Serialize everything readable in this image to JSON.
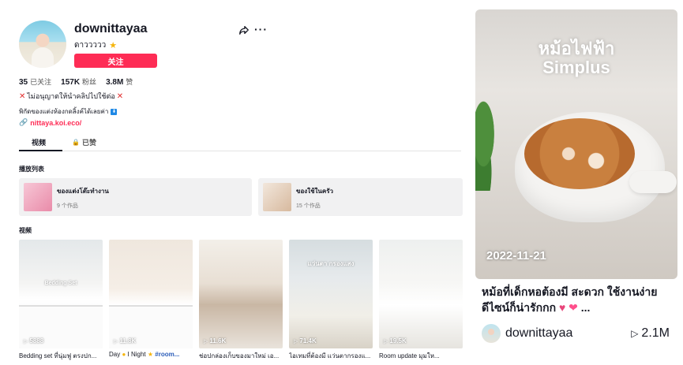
{
  "profile": {
    "username": "downittayaa",
    "nickname": "ดาววววว",
    "follow_label": "关注",
    "stats": [
      {
        "value": "35",
        "label": "已关注"
      },
      {
        "value": "157K",
        "label": "粉丝"
      },
      {
        "value": "3.8M",
        "label": "赞"
      }
    ],
    "bio_line1": "ไม่อนุญาตให้นำคลิปไปใช้ต่อ",
    "bio_line2": "พิกัดของแต่งห้องกดลิ้งค์ได้เลยค่า",
    "link": "nittaya.koi.eco/"
  },
  "tabs": {
    "videos": "视频",
    "liked": "已赞"
  },
  "playlists": {
    "title": "播放列表",
    "items": [
      {
        "name": "ของแต่งโต๊ะทำงาน",
        "count": "9 个作品"
      },
      {
        "name": "ของใช้ในครัว",
        "count": "15 个作品"
      }
    ]
  },
  "videos": {
    "title": "视频",
    "items": [
      {
        "views": "5888",
        "caption": "Bedding set ที่นุ่มฟู ตรงปก...",
        "overlay": "Bedding Set"
      },
      {
        "views": "11.8K",
        "caption_pre": "Day ",
        "caption_mid": " I Night ",
        "caption_tag": "#room...",
        "overlay": ""
      },
      {
        "views": "11.6K",
        "caption": "ช่อปกล่องเก็บของมาใหม่ เอ...",
        "overlay": ""
      },
      {
        "views": "71.4K",
        "caption": "ไอเทมที่ต้องมี แว่นตากรองแ...",
        "overlay": "แว่นตา กรองแสง"
      },
      {
        "views": "19.5K",
        "caption": "Room update  มุมให...",
        "overlay": ""
      }
    ]
  },
  "featured": {
    "title_line1": "หม้อไฟฟ้า",
    "title_line2": "Simplus",
    "date": "2022-11-21",
    "description": "หม้อที่เด็กหอต้องมี สะดวก ใช้งานง่าย ดีไซน์ก็น่ารักกก",
    "ellipsis": "...",
    "author": "downittayaa",
    "views": "2.1M"
  }
}
